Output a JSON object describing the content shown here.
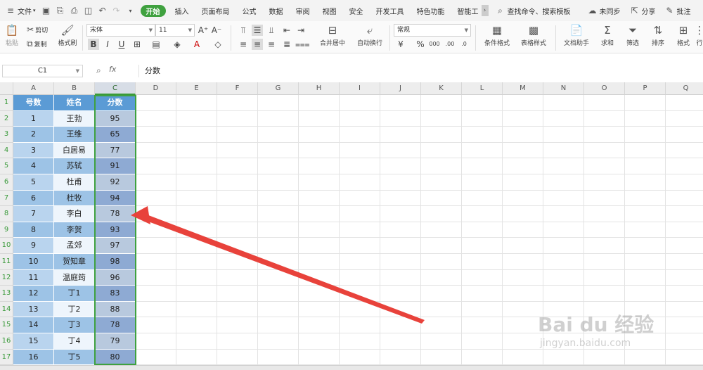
{
  "topbar": {
    "menu_label": "文件",
    "tabs": [
      "开始",
      "插入",
      "页面布局",
      "公式",
      "数据",
      "审阅",
      "视图",
      "安全",
      "开发工具",
      "特色功能",
      "智能工"
    ],
    "active_tab": "开始",
    "search_label": "查找命令、搜索模板",
    "sync_label": "未同步",
    "share_label": "分享",
    "comment_label": "批注"
  },
  "ribbon": {
    "paste": "粘贴",
    "cut": "剪切",
    "copy": "复制",
    "format_painter": "格式刷",
    "font_name": "宋体",
    "font_size": "11",
    "merge_center": "合并居中",
    "auto_wrap": "自动换行",
    "number_format": "常规",
    "conditional_format": "条件格式",
    "table_style": "表格样式",
    "doc_assistant": "文档助手",
    "sum": "求和",
    "filter": "筛选",
    "sort": "排序",
    "format": "格式",
    "row_col": "行"
  },
  "formula_bar": {
    "cell_ref": "C1",
    "fx_label": "fx",
    "content": "分数"
  },
  "columns": [
    "A",
    "B",
    "C",
    "D",
    "E",
    "F",
    "G",
    "H",
    "I",
    "J",
    "K",
    "L",
    "M",
    "N",
    "O",
    "P",
    "Q"
  ],
  "selected_column": "C",
  "rows": [
    {
      "n": "1",
      "a": "号数",
      "b": "姓名",
      "c": "分数"
    },
    {
      "n": "2",
      "a": "1",
      "b": "王勃",
      "c": "95"
    },
    {
      "n": "3",
      "a": "2",
      "b": "王维",
      "c": "65"
    },
    {
      "n": "4",
      "a": "3",
      "b": "白居易",
      "c": "77"
    },
    {
      "n": "5",
      "a": "4",
      "b": "苏轼",
      "c": "91"
    },
    {
      "n": "6",
      "a": "5",
      "b": "杜甫",
      "c": "92"
    },
    {
      "n": "7",
      "a": "6",
      "b": "杜牧",
      "c": "94"
    },
    {
      "n": "8",
      "a": "7",
      "b": "李白",
      "c": "78"
    },
    {
      "n": "9",
      "a": "8",
      "b": "李贺",
      "c": "93"
    },
    {
      "n": "10",
      "a": "9",
      "b": "孟郊",
      "c": "97"
    },
    {
      "n": "11",
      "a": "10",
      "b": "贺知章",
      "c": "98"
    },
    {
      "n": "12",
      "a": "11",
      "b": "温庭筠",
      "c": "96"
    },
    {
      "n": "13",
      "a": "12",
      "b": "丁1",
      "c": "83"
    },
    {
      "n": "14",
      "a": "13",
      "b": "丁2",
      "c": "88"
    },
    {
      "n": "15",
      "a": "14",
      "b": "丁3",
      "c": "78"
    },
    {
      "n": "16",
      "a": "15",
      "b": "丁4",
      "c": "79"
    },
    {
      "n": "17",
      "a": "16",
      "b": "丁5",
      "c": "80"
    }
  ],
  "watermark": {
    "brand": "Bai du 经验",
    "url": "jingyan.baidu.com"
  },
  "colors": {
    "header_fill": "#5b9bd5",
    "band_dark": "#9dc3e6",
    "band_light": "#ddebf7",
    "selected_col": "#8eaad3",
    "arrow": "#e8423b",
    "accent": "#3fa13f"
  }
}
